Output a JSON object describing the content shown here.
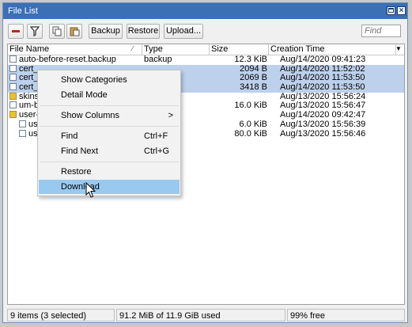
{
  "window": {
    "title": "File List"
  },
  "toolbar": {
    "backup_label": "Backup",
    "restore_label": "Restore",
    "upload_label": "Upload...",
    "find_placeholder": "Find"
  },
  "table": {
    "columns": [
      "File Name",
      "Type",
      "Size",
      "Creation Time"
    ],
    "rows": [
      {
        "name": "auto-before-reset.backup",
        "type": "backup",
        "size": "12.3 KiB",
        "time": "Aug/14/2020 09:41:23",
        "icon": "file",
        "selected": false
      },
      {
        "name": "cert_",
        "type": "",
        "size": "2094 B",
        "time": "Aug/14/2020 11:52:02",
        "icon": "file",
        "selected": true
      },
      {
        "name": "cert_",
        "type": "",
        "size": "2069 B",
        "time": "Aug/14/2020 11:53:50",
        "icon": "file",
        "selected": true
      },
      {
        "name": "cert_",
        "type": "",
        "size": "3418 B",
        "time": "Aug/14/2020 11:53:50",
        "icon": "file",
        "selected": true
      },
      {
        "name": "skins",
        "type": "",
        "size": "",
        "time": "Aug/13/2020 15:56:24",
        "icon": "folder",
        "selected": false
      },
      {
        "name": "um-b",
        "type": "",
        "size": "16.0 KiB",
        "time": "Aug/13/2020 15:56:47",
        "icon": "file",
        "selected": false
      },
      {
        "name": "user-",
        "type": "",
        "size": "",
        "time": "Aug/14/2020 09:42:47",
        "icon": "folder",
        "selected": false
      },
      {
        "name": "us",
        "type": "",
        "size": "6.0 KiB",
        "time": "Aug/13/2020 15:56:39",
        "icon": "file",
        "selected": false,
        "indent": true
      },
      {
        "name": "us",
        "type": "",
        "size": "80.0 KiB",
        "time": "Aug/13/2020 15:56:46",
        "icon": "file",
        "selected": false,
        "indent": true
      }
    ]
  },
  "status": {
    "items": "9 items (3 selected)",
    "used": "91.2 MiB of 11.9 GiB used",
    "free": "99% free"
  },
  "context_menu": {
    "show_categories": "Show Categories",
    "detail_mode": "Detail Mode",
    "show_columns": "Show Columns",
    "show_columns_arrow": ">",
    "find": "Find",
    "find_shortcut": "Ctrl+F",
    "find_next": "Find Next",
    "find_next_shortcut": "Ctrl+G",
    "restore": "Restore",
    "download": "Download"
  },
  "colors": {
    "titlebar": "#3b6fb6",
    "selection": "#bdd0ec",
    "menu_highlight": "#99c9ef"
  }
}
